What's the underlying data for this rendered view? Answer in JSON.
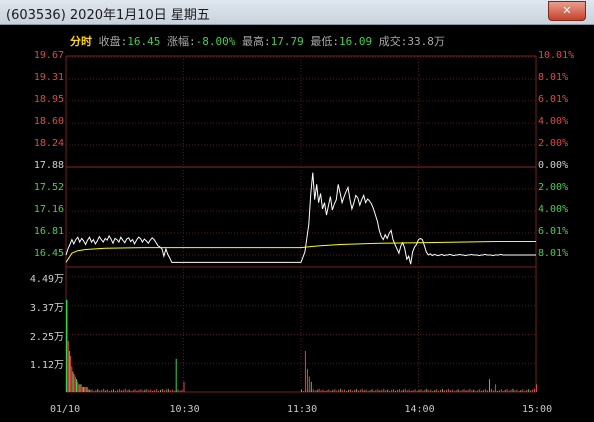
{
  "window": {
    "title": "(603536) 2020年1月10日 星期五",
    "close_glyph": "✕"
  },
  "info": {
    "mode": "分时",
    "close_label": "收盘:",
    "close_value": "16.45",
    "change_label": "涨幅:",
    "change_value": "-8.00%",
    "high_label": "最高:",
    "high_value": "17.79",
    "low_label": "最低:",
    "low_value": "16.09",
    "volume_label": "成交:",
    "volume_value": "33.8万"
  },
  "chart_data": {
    "type": "line",
    "price_ticks": [
      "19.67",
      "19.31",
      "18.95",
      "18.60",
      "18.24",
      "17.88",
      "17.52",
      "17.16",
      "16.81",
      "16.45"
    ],
    "pct_ticks": [
      "10.01%",
      "8.01%",
      "6.01%",
      "4.00%",
      "2.00%",
      "0.00%",
      "2.00%",
      "4.00%",
      "6.01%",
      "8.01%"
    ],
    "volume_ticks": [
      "4.49万",
      "3.37万",
      "2.25万",
      "1.12万"
    ],
    "x_ticks": [
      "01/10",
      "10:30",
      "11:30",
      "14:00",
      "15:00"
    ],
    "prev_close": 17.88,
    "price_ylim": [
      16.09,
      19.67
    ],
    "volume_ylim": [
      0,
      4.49
    ],
    "price_series": {
      "name": "price",
      "color": "#ffffff",
      "x": [
        0,
        1,
        2,
        3,
        4,
        5,
        6,
        7,
        8,
        9,
        10,
        11,
        12,
        13,
        14,
        15,
        16,
        17,
        18,
        19,
        20,
        21,
        22,
        23,
        24,
        25,
        26,
        27,
        28,
        29,
        30,
        31,
        32,
        33,
        34,
        35,
        36,
        37,
        38,
        39,
        40,
        41,
        42,
        43,
        44,
        45,
        46,
        47,
        48,
        49,
        50,
        51,
        52,
        53,
        54,
        55,
        56,
        57,
        58,
        59,
        60,
        61,
        62,
        63,
        64,
        65,
        66,
        67,
        68,
        69,
        70,
        71,
        72,
        73,
        74,
        75,
        76,
        77,
        78,
        79,
        80,
        81,
        82,
        83,
        84,
        85,
        86,
        87,
        88,
        89,
        90,
        91,
        92,
        93,
        94,
        95,
        96,
        97,
        98,
        99,
        100,
        101,
        102,
        103,
        104,
        105,
        106,
        107,
        108,
        109,
        110,
        111,
        112,
        113,
        114,
        115,
        116,
        117,
        118,
        119,
        120,
        121,
        122,
        123,
        124,
        125,
        126,
        127,
        128,
        129,
        130,
        131,
        132,
        133,
        134,
        135,
        136,
        137,
        138,
        139,
        140,
        141,
        142,
        143,
        144,
        145,
        146,
        147,
        148,
        149,
        150,
        151,
        152,
        153,
        154,
        155,
        156,
        157,
        158,
        159,
        160,
        161,
        162,
        163,
        164,
        165,
        166,
        167,
        168,
        169,
        170,
        171,
        172,
        173,
        174,
        175,
        176,
        177,
        178,
        179,
        180,
        181,
        182,
        183,
        184,
        185,
        186,
        187,
        188,
        189,
        190,
        191,
        192,
        193,
        194,
        195,
        196,
        197,
        198,
        199,
        200,
        201,
        202,
        203,
        204,
        205,
        206,
        207,
        208,
        209,
        210,
        211,
        212,
        213,
        214,
        215,
        216,
        217,
        218,
        219,
        220,
        221,
        222,
        223,
        224,
        225,
        226,
        227,
        228,
        229,
        230,
        231,
        232,
        233,
        234,
        235,
        236,
        237,
        238,
        239,
        240
      ],
      "values": [
        16.45,
        16.55,
        16.62,
        16.7,
        16.63,
        16.7,
        16.74,
        16.66,
        16.72,
        16.68,
        16.62,
        16.69,
        16.74,
        16.66,
        16.7,
        16.63,
        16.68,
        16.75,
        16.7,
        16.66,
        16.72,
        16.69,
        16.76,
        16.71,
        16.64,
        16.72,
        16.7,
        16.66,
        16.74,
        16.69,
        16.65,
        16.71,
        16.73,
        16.67,
        16.7,
        16.63,
        16.69,
        16.74,
        16.72,
        16.66,
        16.71,
        16.68,
        16.64,
        16.69,
        16.73,
        16.7,
        16.65,
        16.6,
        16.58,
        16.55,
        16.43,
        16.55,
        16.46,
        16.4,
        16.33,
        16.33,
        16.33,
        16.33,
        16.33,
        16.33,
        16.33,
        16.33,
        16.33,
        16.33,
        16.33,
        16.33,
        16.33,
        16.33,
        16.33,
        16.33,
        16.33,
        16.33,
        16.33,
        16.33,
        16.33,
        16.33,
        16.33,
        16.33,
        16.33,
        16.33,
        16.33,
        16.33,
        16.33,
        16.33,
        16.33,
        16.33,
        16.33,
        16.33,
        16.33,
        16.33,
        16.33,
        16.33,
        16.33,
        16.33,
        16.33,
        16.33,
        16.33,
        16.33,
        16.33,
        16.33,
        16.33,
        16.33,
        16.33,
        16.33,
        16.33,
        16.33,
        16.33,
        16.33,
        16.33,
        16.33,
        16.33,
        16.33,
        16.33,
        16.33,
        16.33,
        16.33,
        16.33,
        16.33,
        16.33,
        16.33,
        16.33,
        16.33,
        16.33,
        16.33,
        16.33,
        16.33,
        16.33,
        16.33,
        16.33,
        16.33,
        16.33,
        16.33,
        16.33,
        16.33,
        16.33,
        16.33,
        16.33,
        16.33,
        16.33,
        16.33,
        16.33,
        16.33,
        16.33,
        16.33,
        16.33,
        16.33,
        16.33,
        16.33,
        16.33,
        16.33,
        16.33,
        16.33,
        16.33,
        16.33,
        16.33,
        16.33,
        16.33,
        16.33,
        16.33,
        16.33,
        16.33,
        16.33,
        16.33,
        16.33,
        16.33,
        16.33,
        16.33,
        16.33,
        16.33,
        16.33,
        16.33,
        16.33,
        16.33,
        16.33,
        16.33,
        16.33,
        16.33,
        16.33,
        16.33,
        16.33,
        16.33,
        16.33,
        16.33,
        16.33,
        16.33,
        16.33,
        16.33,
        16.33,
        16.33,
        16.33,
        16.33,
        16.33,
        16.33,
        16.33,
        16.33,
        16.33,
        16.33,
        16.33,
        16.33,
        16.33,
        16.33,
        16.33,
        16.33,
        16.33,
        16.33,
        16.33,
        16.33,
        16.33,
        16.33,
        16.33,
        16.33,
        16.33,
        16.33,
        16.33,
        16.33,
        16.33,
        16.33,
        16.33,
        16.33,
        16.33,
        16.33,
        16.33,
        16.33,
        16.33,
        16.33,
        16.33,
        16.33,
        16.33,
        16.33,
        16.33,
        16.33,
        16.33,
        16.33,
        16.33,
        16.33,
        16.33,
        16.33
      ]
    },
    "price_series_pm": {
      "name": "price_pm",
      "x": [
        120,
        122,
        124,
        125,
        126,
        127,
        128,
        129,
        130,
        131,
        132,
        133,
        134,
        135,
        136,
        137,
        138,
        139,
        140,
        141,
        142,
        143,
        144,
        145,
        146,
        147,
        148,
        149,
        150,
        151,
        152,
        153,
        154,
        155,
        156,
        157,
        158,
        159,
        160,
        161,
        162,
        163,
        164,
        165,
        166,
        167,
        168,
        169,
        170,
        171,
        172,
        173,
        174,
        175,
        176,
        177,
        178,
        179,
        180,
        181,
        182,
        183,
        184,
        185,
        186,
        187,
        188,
        189,
        190,
        191,
        192,
        193,
        194,
        195,
        196,
        197,
        198,
        199,
        200,
        201,
        202,
        203,
        204,
        205,
        206,
        207,
        208,
        209,
        210,
        211,
        212,
        213,
        214,
        215,
        216,
        217,
        218,
        219,
        220,
        221,
        222,
        223,
        224,
        225,
        226,
        227,
        228,
        229,
        230,
        231,
        232,
        233,
        234,
        235,
        236,
        237,
        238,
        239,
        240
      ],
      "values": [
        16.33,
        16.5,
        16.95,
        17.45,
        17.79,
        17.35,
        17.6,
        17.3,
        17.45,
        17.2,
        17.3,
        17.1,
        17.25,
        17.4,
        17.18,
        17.28,
        17.35,
        17.6,
        17.45,
        17.3,
        17.4,
        17.48,
        17.55,
        17.35,
        17.2,
        17.3,
        17.42,
        17.38,
        17.26,
        17.35,
        17.42,
        17.3,
        17.36,
        17.33,
        17.28,
        17.2,
        17.1,
        17.0,
        16.85,
        16.75,
        16.7,
        16.78,
        16.72,
        16.8,
        16.85,
        16.7,
        16.62,
        16.55,
        16.48,
        16.6,
        16.65,
        16.55,
        16.38,
        16.43,
        16.3,
        16.5,
        16.58,
        16.62,
        16.7,
        16.72,
        16.7,
        16.6,
        16.5,
        16.45,
        16.47,
        16.44,
        16.46,
        16.45,
        16.44,
        16.45,
        16.46,
        16.44,
        16.45,
        16.45,
        16.46,
        16.45,
        16.44,
        16.45,
        16.45,
        16.46,
        16.45,
        16.45,
        16.44,
        16.45,
        16.45,
        16.46,
        16.45,
        16.45,
        16.45,
        16.44,
        16.45,
        16.45,
        16.46,
        16.45,
        16.45,
        16.45,
        16.44,
        16.45,
        16.45,
        16.45,
        16.46,
        16.45,
        16.45,
        16.45,
        16.45,
        16.45,
        16.45,
        16.45,
        16.45,
        16.45,
        16.45,
        16.45,
        16.45,
        16.45,
        16.45,
        16.45,
        16.45,
        16.45,
        16.45
      ]
    },
    "avg_series": {
      "name": "average",
      "color": "#ffff00",
      "x": [
        0,
        3,
        6,
        10,
        20,
        40,
        60,
        80,
        100,
        118,
        120,
        126,
        130,
        140,
        160,
        180,
        200,
        220,
        240
      ],
      "values": [
        16.33,
        16.48,
        16.52,
        16.54,
        16.56,
        16.57,
        16.57,
        16.57,
        16.57,
        16.57,
        16.57,
        16.59,
        16.6,
        16.62,
        16.64,
        16.65,
        16.66,
        16.67,
        16.67
      ]
    },
    "volume_bars_red": [
      3.6,
      2.0,
      1.6,
      1.4,
      1.0,
      0.8,
      0.7,
      0.6,
      0.5,
      0.4,
      0.3,
      0.3,
      0.3,
      0.2,
      0.2,
      0.2,
      0.2,
      0.2,
      0.1,
      0.1
    ],
    "volume_notable": [
      {
        "x": 0,
        "v": 3.6,
        "color": "#3fd24f"
      },
      {
        "x": 56,
        "v": 1.3,
        "color": "#3fd24f"
      },
      {
        "x": 60,
        "v": 0.4,
        "color": "#e04848"
      },
      {
        "x": 122,
        "v": 1.6,
        "color": "#e04848"
      },
      {
        "x": 123,
        "v": 0.9,
        "color": "#e04848"
      },
      {
        "x": 124,
        "v": 0.6,
        "color": "#e04848"
      },
      {
        "x": 125,
        "v": 0.4,
        "color": "#3fd24f"
      },
      {
        "x": 216,
        "v": 0.5,
        "color": "#3fd24f"
      },
      {
        "x": 219,
        "v": 0.3,
        "color": "#e04848"
      },
      {
        "x": 240,
        "v": 0.3,
        "color": "#e04848"
      }
    ],
    "grid": true
  }
}
